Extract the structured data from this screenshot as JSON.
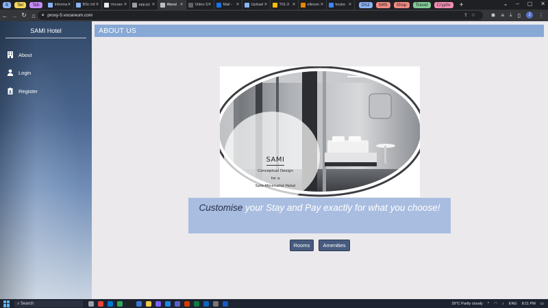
{
  "browser": {
    "tab_chips": [
      {
        "label": "B",
        "color": "#8ab4f8"
      },
      {
        "label": "Twi",
        "color": "#f6d55c"
      },
      {
        "label": "Tab",
        "color": "#c58af9"
      }
    ],
    "tabs": [
      {
        "label": "Informa"
      },
      {
        "label": "BSc Inf"
      },
      {
        "label": "Vocare"
      },
      {
        "label": "app.py"
      },
      {
        "label": "About",
        "active": true
      },
      {
        "label": "Video S"
      },
      {
        "label": "Mail -"
      },
      {
        "label": "Upload"
      },
      {
        "label": "T01-3"
      },
      {
        "label": "elleson"
      },
      {
        "label": "keybo"
      }
    ],
    "right_chips": [
      {
        "label": "DS2",
        "color": "#8ab4f8"
      },
      {
        "label": "SMS",
        "color": "#f28b82"
      },
      {
        "label": "Shop",
        "color": "#f28b82"
      },
      {
        "label": "Travel",
        "color": "#81c995"
      },
      {
        "label": "Crypto",
        "color": "#f48fb1"
      }
    ],
    "url": "proxy-5.vocareum.com",
    "profile_initial": "J"
  },
  "sidebar": {
    "brand": "SAMI Hotel",
    "items": [
      {
        "label": "About",
        "icon": "hotel-icon"
      },
      {
        "label": "Login",
        "icon": "user-icon"
      },
      {
        "label": "Register",
        "icon": "id-badge-icon"
      }
    ]
  },
  "page": {
    "header": "ABOUT US",
    "hero_caption": {
      "title": "SAMI",
      "line1": "Conceptual Design",
      "line2": "for a",
      "line3": "Safe-Minimalist Hotel"
    },
    "tagline_em": "Customise",
    "tagline_rest": "your Stay and Pay exactly for what you choose!",
    "buttons": {
      "rooms": "Rooms",
      "amenities": "Amenities"
    }
  },
  "taskbar": {
    "search_placeholder": "Search",
    "weather": "29°C  Partly cloudy",
    "lang": "ENG",
    "time": "8:11 PM"
  }
}
